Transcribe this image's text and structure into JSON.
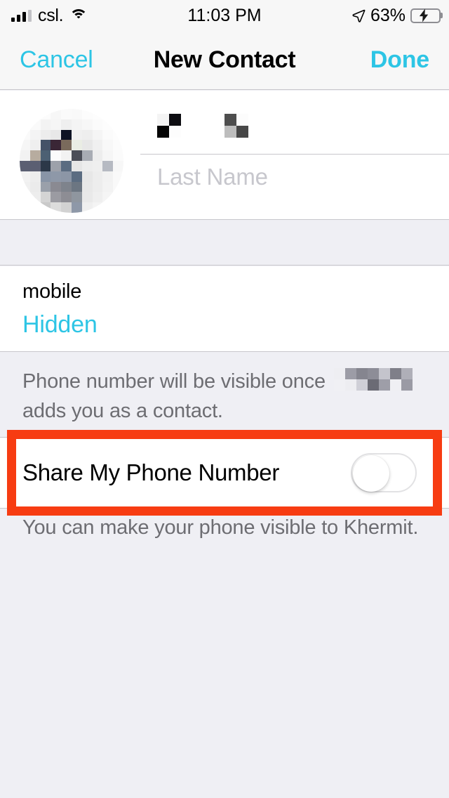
{
  "status_bar": {
    "carrier": "csl.",
    "time": "11:03 PM",
    "battery_percent": "63%",
    "signal_bars_filled": 3,
    "signal_bars_total": 4,
    "wifi_icon": "wifi-icon",
    "location_icon": "location-arrow-icon",
    "battery_icon": "battery-charging-icon",
    "battery_charging": true,
    "battery_fill_color": "#34C759"
  },
  "nav_bar": {
    "cancel_label": "Cancel",
    "title": "New Contact",
    "done_label": "Done",
    "accent_color": "#2DC5E5"
  },
  "contact_header": {
    "avatar_icon": "contact-photo-pixelated",
    "first_name_value": "",
    "first_name_redacted": true,
    "last_name_placeholder": "Last Name",
    "last_name_value": ""
  },
  "phone_section": {
    "label": "mobile",
    "value": "Hidden",
    "value_color": "#2DC5E5"
  },
  "note_visibility": {
    "text_before": "Phone number will be visible once",
    "redacted_name": true,
    "text_after": "adds you as a contact."
  },
  "share_row": {
    "label": "Share My Phone Number",
    "toggle_state": "off",
    "toggle_on": false
  },
  "note_share": {
    "text": "You can make your phone visible to Khermit."
  },
  "annotation": {
    "highlight_color": "#F73C12",
    "target": "share-my-phone-number-row"
  }
}
